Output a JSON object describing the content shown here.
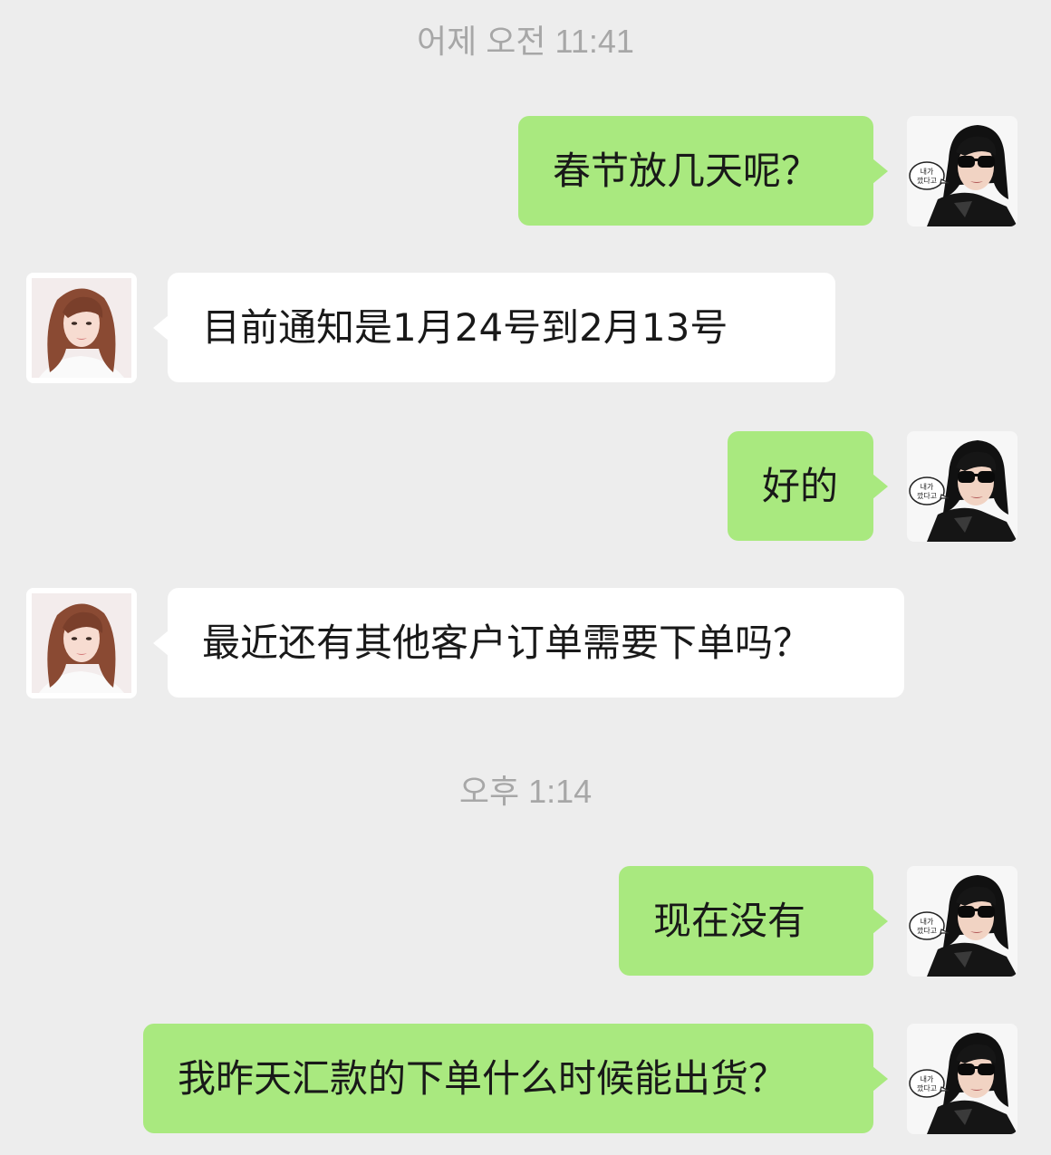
{
  "chat": {
    "timestamps": [
      "어제 오전 11:41",
      "오후 1:14"
    ],
    "messages": [
      {
        "side": "sent",
        "text": "春节放几天呢？"
      },
      {
        "side": "received",
        "text": "目前通知是1月24号到2月13号"
      },
      {
        "side": "sent",
        "text": "好的"
      },
      {
        "side": "received",
        "text": "最近还有其他客户订单需要下单吗？"
      },
      {
        "side": "sent",
        "text": "现在没有"
      },
      {
        "side": "sent",
        "text": "我昨天汇款的下单什么时候能出货？"
      }
    ]
  },
  "avatars": {
    "me": {
      "icon": "sunglasses-woman-avatar",
      "speech_text": "내가 깠다고"
    },
    "contact": {
      "icon": "woman-portrait-avatar"
    }
  },
  "colors": {
    "background": "#ededed",
    "sent_bubble": "#a9e97f",
    "received_bubble": "#ffffff",
    "timestamp": "#a7a7a7",
    "text": "#191919"
  }
}
